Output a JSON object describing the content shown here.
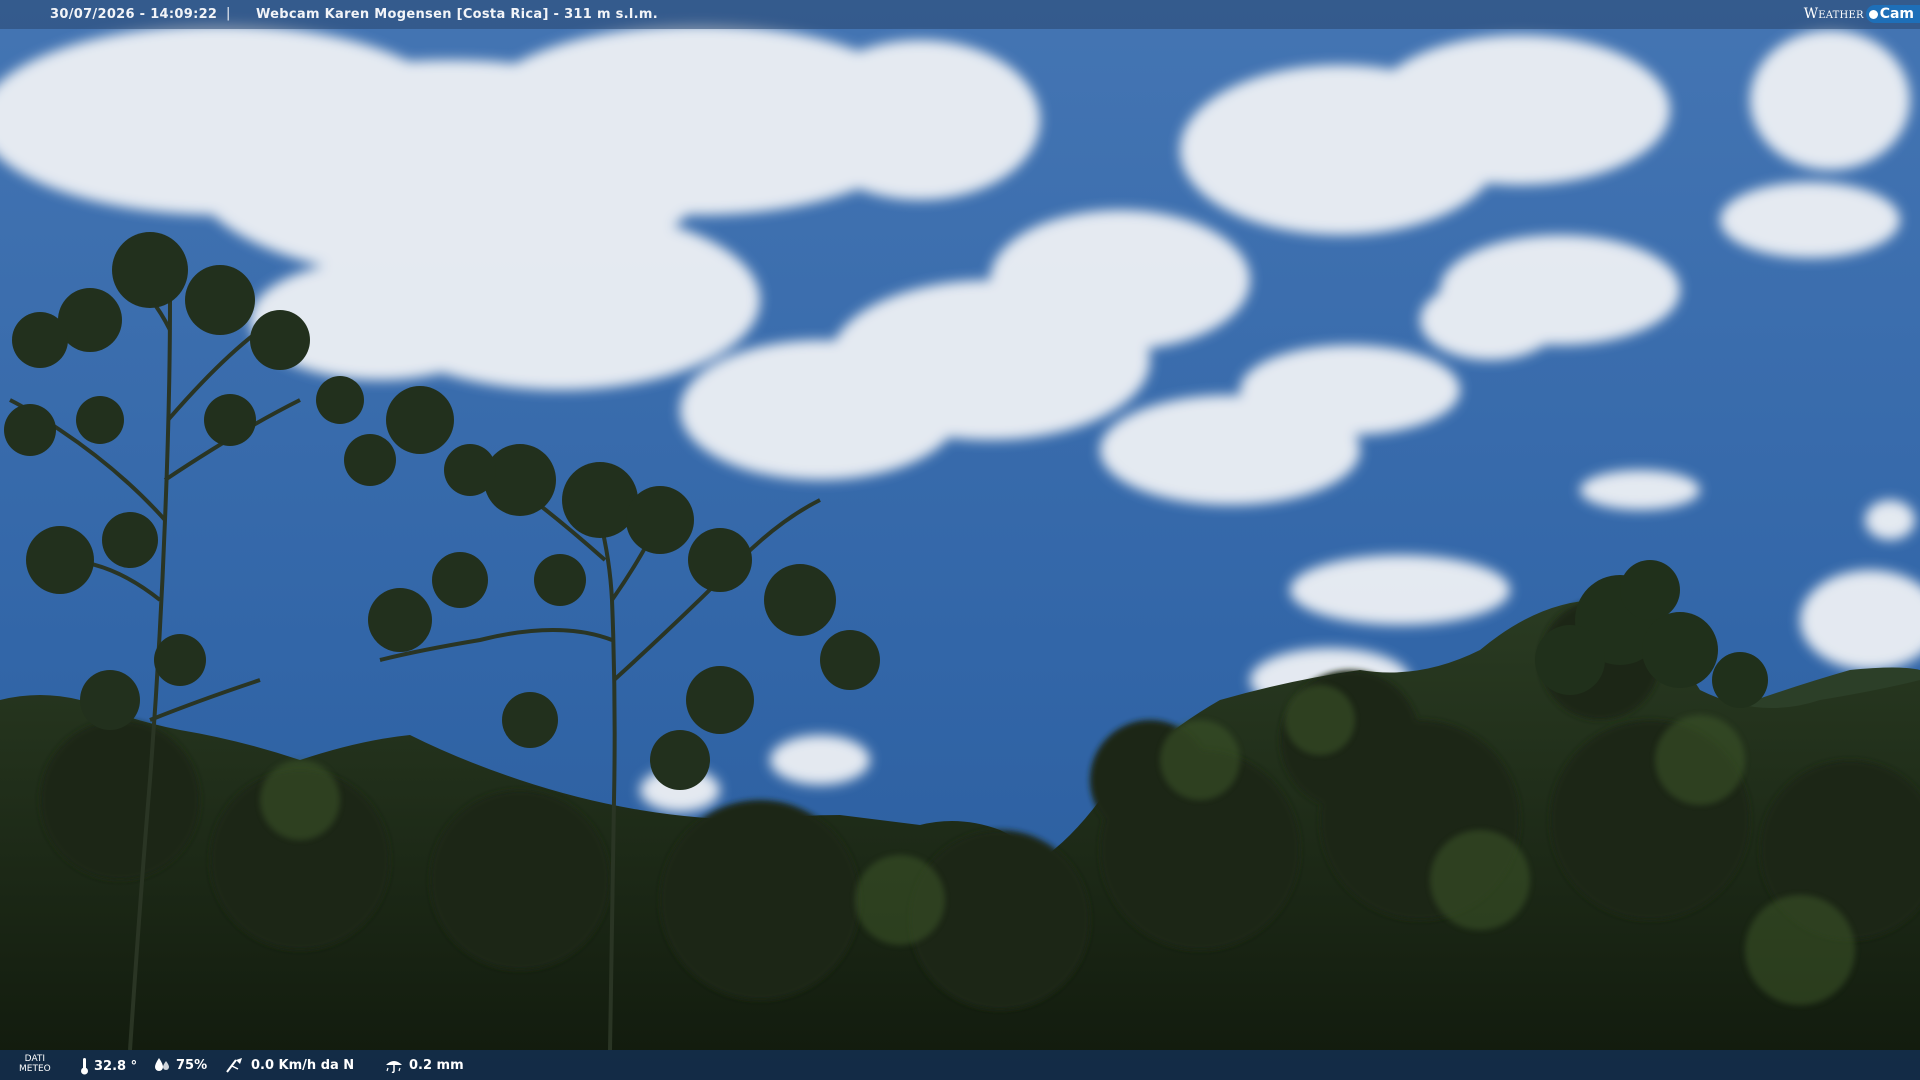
{
  "header": {
    "timestamp": "30/07/2026 - 14:09:22",
    "separator": "|",
    "title": "Webcam Karen Mogensen [Costa Rica]  - 311 m s.l.m."
  },
  "logo": {
    "word1": "Weather",
    "word2": "Cam"
  },
  "weather_bar": {
    "label_line1": "DATI",
    "label_line2": "METEO",
    "temperature": "32.8 °",
    "humidity": "75%",
    "wind": "0.0 Km/h da N",
    "rain": "0.2 mm"
  },
  "icons": [
    "thermometer-icon",
    "humidity-drop-icon",
    "wind-icon",
    "rain-icon"
  ],
  "colors": {
    "sky": "#3b6fb0",
    "cloud": "#eef1f5",
    "forest": "#1c2b17",
    "bar": "#14325a",
    "logo_accent": "#1e6fb8"
  }
}
